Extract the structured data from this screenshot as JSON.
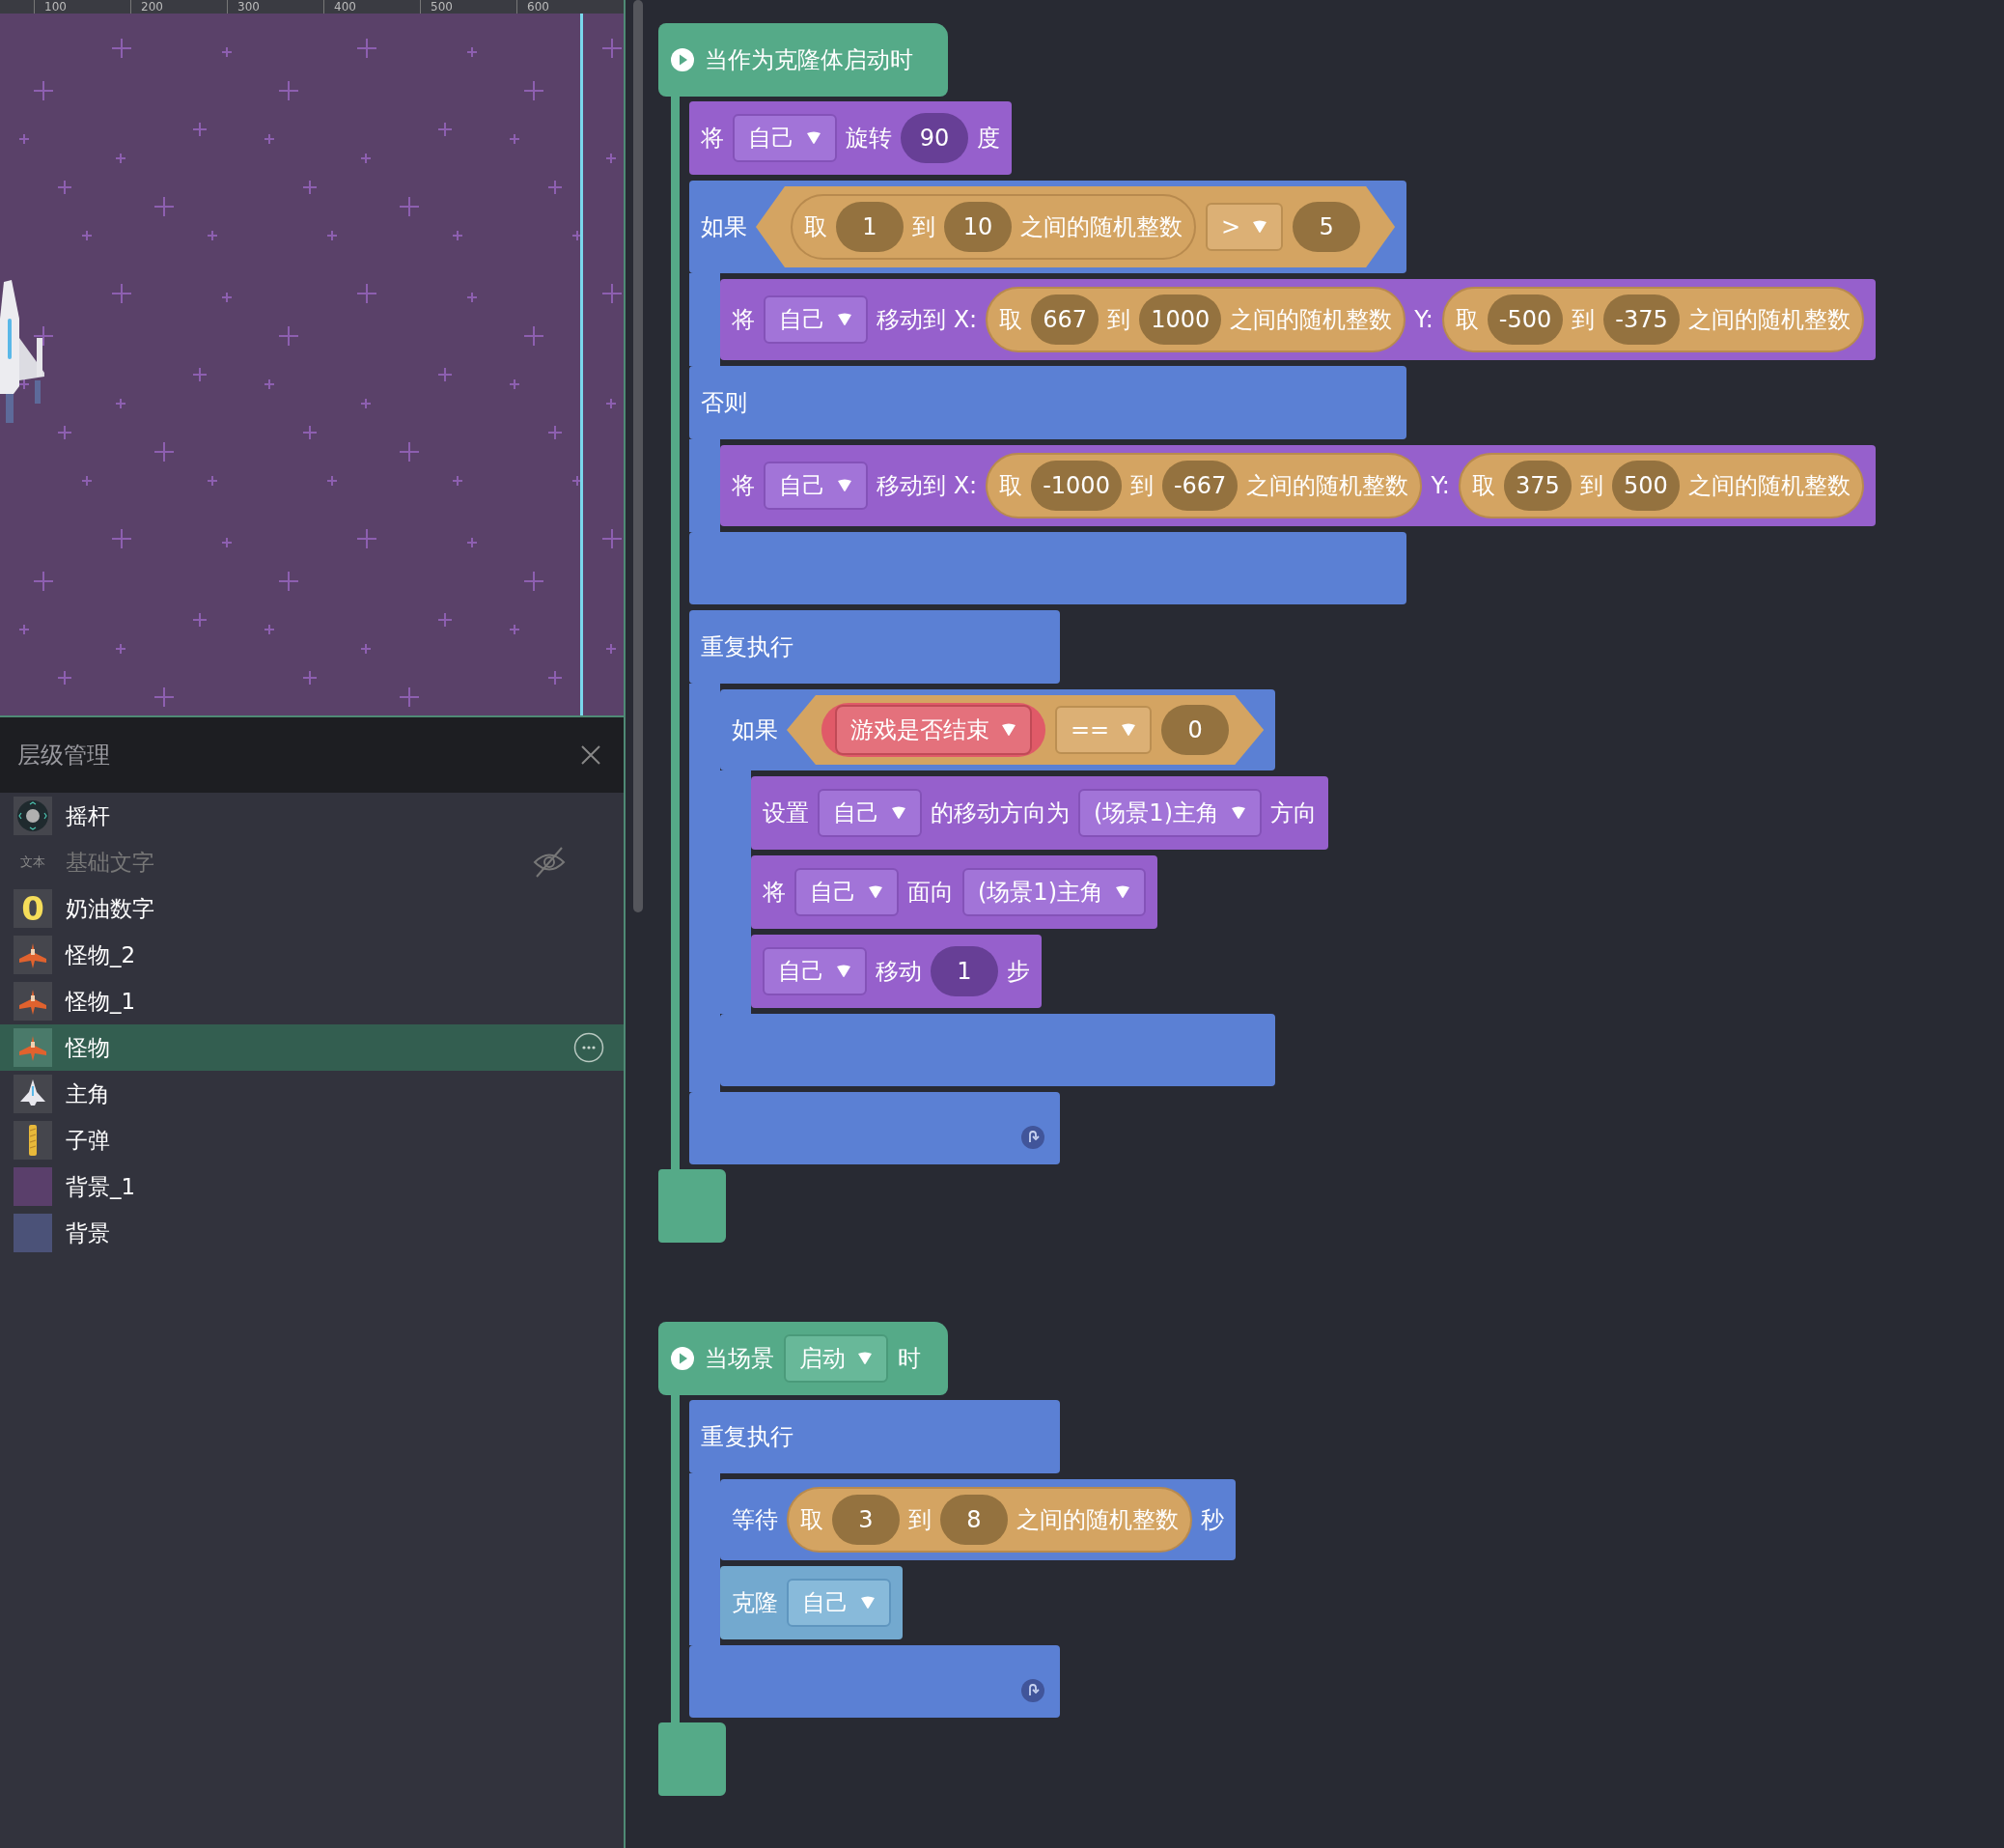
{
  "stage": {
    "ruler_labels": [
      "100",
      "200",
      "300",
      "400",
      "500",
      "600"
    ]
  },
  "layers": {
    "title": "层级管理",
    "items": [
      {
        "name": "摇杆",
        "kind": "joystick",
        "selected": false,
        "hidden": false
      },
      {
        "name": "基础文字",
        "kind": "text",
        "thumb_text": "文本",
        "selected": false,
        "hidden": true
      },
      {
        "name": "奶油数字",
        "kind": "number",
        "thumb_text": "0",
        "selected": false,
        "hidden": false
      },
      {
        "name": "怪物_2",
        "kind": "monster",
        "selected": false,
        "hidden": false
      },
      {
        "name": "怪物_1",
        "kind": "monster",
        "selected": false,
        "hidden": false
      },
      {
        "name": "怪物",
        "kind": "monster",
        "selected": true,
        "hidden": false
      },
      {
        "name": "主角",
        "kind": "player",
        "selected": false,
        "hidden": false
      },
      {
        "name": "子弹",
        "kind": "bullet",
        "selected": false,
        "hidden": false
      },
      {
        "name": "背景_1",
        "kind": "background",
        "color": "#5a3f6b",
        "selected": false,
        "hidden": false
      },
      {
        "name": "背景",
        "kind": "background",
        "color": "#4b5278",
        "selected": false,
        "hidden": false
      }
    ]
  },
  "scripts": [
    {
      "hat": {
        "parts": [
          {
            "kind": "label",
            "text": "当作为克隆体启动时"
          }
        ]
      },
      "body": [
        {
          "kind": "motion",
          "parts": [
            {
              "kind": "label",
              "text": "将"
            },
            {
              "kind": "dropdown",
              "text": "自己"
            },
            {
              "kind": "label",
              "text": "旋转"
            },
            {
              "kind": "number",
              "text": "90"
            },
            {
              "kind": "label",
              "text": "度"
            }
          ]
        },
        {
          "kind": "if_else",
          "parts": [
            {
              "kind": "label",
              "text": "如果"
            },
            {
              "kind": "boolean",
              "parts": [
                {
                  "kind": "reporter",
                  "parts": [
                    {
                      "kind": "label",
                      "text": "取"
                    },
                    {
                      "kind": "number",
                      "text": "1"
                    },
                    {
                      "kind": "label",
                      "text": "到"
                    },
                    {
                      "kind": "number",
                      "text": "10"
                    },
                    {
                      "kind": "label",
                      "text": "之间的随机整数"
                    }
                  ]
                },
                {
                  "kind": "dropdown",
                  "text": ">"
                },
                {
                  "kind": "number",
                  "text": "5"
                }
              ]
            }
          ],
          "then": [
            {
              "kind": "motion",
              "parts": [
                {
                  "kind": "label",
                  "text": "将"
                },
                {
                  "kind": "dropdown",
                  "text": "自己"
                },
                {
                  "kind": "label",
                  "text": "移动到 X:"
                },
                {
                  "kind": "reporter",
                  "parts": [
                    {
                      "kind": "label",
                      "text": "取"
                    },
                    {
                      "kind": "number",
                      "text": "667"
                    },
                    {
                      "kind": "label",
                      "text": "到"
                    },
                    {
                      "kind": "number",
                      "text": "1000"
                    },
                    {
                      "kind": "label",
                      "text": "之间的随机整数"
                    }
                  ]
                },
                {
                  "kind": "label",
                  "text": "Y:"
                },
                {
                  "kind": "reporter",
                  "parts": [
                    {
                      "kind": "label",
                      "text": "取"
                    },
                    {
                      "kind": "number",
                      "text": "-500"
                    },
                    {
                      "kind": "label",
                      "text": "到"
                    },
                    {
                      "kind": "number",
                      "text": "-375"
                    },
                    {
                      "kind": "label",
                      "text": "之间的随机整数"
                    }
                  ]
                }
              ]
            }
          ],
          "else_label": "否则",
          "else": [
            {
              "kind": "motion",
              "parts": [
                {
                  "kind": "label",
                  "text": "将"
                },
                {
                  "kind": "dropdown",
                  "text": "自己"
                },
                {
                  "kind": "label",
                  "text": "移动到 X:"
                },
                {
                  "kind": "reporter",
                  "parts": [
                    {
                      "kind": "label",
                      "text": "取"
                    },
                    {
                      "kind": "number",
                      "text": "-1000"
                    },
                    {
                      "kind": "label",
                      "text": "到"
                    },
                    {
                      "kind": "number",
                      "text": "-667"
                    },
                    {
                      "kind": "label",
                      "text": "之间的随机整数"
                    }
                  ]
                },
                {
                  "kind": "label",
                  "text": "Y:"
                },
                {
                  "kind": "reporter",
                  "parts": [
                    {
                      "kind": "label",
                      "text": "取"
                    },
                    {
                      "kind": "number",
                      "text": "375"
                    },
                    {
                      "kind": "label",
                      "text": "到"
                    },
                    {
                      "kind": "number",
                      "text": "500"
                    },
                    {
                      "kind": "label",
                      "text": "之间的随机整数"
                    }
                  ]
                }
              ]
            }
          ]
        },
        {
          "kind": "forever",
          "parts": [
            {
              "kind": "label",
              "text": "重复执行"
            }
          ],
          "body": [
            {
              "kind": "if",
              "parts": [
                {
                  "kind": "label",
                  "text": "如果"
                },
                {
                  "kind": "boolean",
                  "parts": [
                    {
                      "kind": "variable",
                      "text": "游戏是否结束"
                    },
                    {
                      "kind": "dropdown",
                      "text": "=="
                    },
                    {
                      "kind": "number",
                      "text": "0"
                    }
                  ]
                }
              ],
              "then": [
                {
                  "kind": "motion",
                  "parts": [
                    {
                      "kind": "label",
                      "text": "设置"
                    },
                    {
                      "kind": "dropdown",
                      "text": "自己"
                    },
                    {
                      "kind": "label",
                      "text": "的移动方向为"
                    },
                    {
                      "kind": "dropdown",
                      "text": "(场景1)主角"
                    },
                    {
                      "kind": "label",
                      "text": "方向"
                    }
                  ]
                },
                {
                  "kind": "motion",
                  "parts": [
                    {
                      "kind": "label",
                      "text": "将"
                    },
                    {
                      "kind": "dropdown",
                      "text": "自己"
                    },
                    {
                      "kind": "label",
                      "text": "面向"
                    },
                    {
                      "kind": "dropdown",
                      "text": "(场景1)主角"
                    }
                  ]
                },
                {
                  "kind": "motion",
                  "parts": [
                    {
                      "kind": "dropdown",
                      "text": "自己"
                    },
                    {
                      "kind": "label",
                      "text": "移动"
                    },
                    {
                      "kind": "number",
                      "text": "1"
                    },
                    {
                      "kind": "label",
                      "text": "步"
                    }
                  ]
                }
              ]
            }
          ]
        }
      ]
    },
    {
      "hat": {
        "parts": [
          {
            "kind": "label",
            "text": "当场景"
          },
          {
            "kind": "dropdown",
            "text": "启动"
          },
          {
            "kind": "label",
            "text": "时"
          }
        ]
      },
      "body": [
        {
          "kind": "forever",
          "parts": [
            {
              "kind": "label",
              "text": "重复执行"
            }
          ],
          "body": [
            {
              "kind": "control",
              "parts": [
                {
                  "kind": "label",
                  "text": "等待"
                },
                {
                  "kind": "reporter",
                  "parts": [
                    {
                      "kind": "label",
                      "text": "取"
                    },
                    {
                      "kind": "number",
                      "text": "3"
                    },
                    {
                      "kind": "label",
                      "text": "到"
                    },
                    {
                      "kind": "number",
                      "text": "8"
                    },
                    {
                      "kind": "label",
                      "text": "之间的随机整数"
                    }
                  ]
                },
                {
                  "kind": "label",
                  "text": "秒"
                }
              ]
            },
            {
              "kind": "clone",
              "parts": [
                {
                  "kind": "label",
                  "text": "克隆"
                },
                {
                  "kind": "dropdown",
                  "text": "自己"
                }
              ]
            }
          ]
        }
      ]
    }
  ]
}
